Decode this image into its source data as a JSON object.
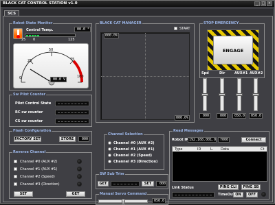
{
  "window": {
    "title": "BLACK CAT CONTROL STATION v1.0",
    "tab": "SCS"
  },
  "colors": {
    "group_title": "#9db7e8",
    "accent_red": "#d90000",
    "engage_stripe": "#e6c800"
  },
  "robot_state_monitor": {
    "title": "Robot State Monitor",
    "control_temp_label": "Control Temp.",
    "control_temp_value": "00.0 °",
    "scale_min": "25",
    "scale_zero": "0",
    "scale_max": "125",
    "gauge_ticks": [
      "0",
      "25",
      "50",
      "75",
      "100"
    ],
    "gauge_readout": "00.0 V"
  },
  "sw_pilot_counter": {
    "title": "Sw Pilot Counter",
    "rows": [
      "Pilot Control State",
      "RC sw counter",
      "CS sw counter"
    ]
  },
  "flash_configuration": {
    "title": "Flash Configuration",
    "factory_set": "FACTORY SET",
    "store": "STORE",
    "store_value": "000"
  },
  "reverse_channel": {
    "title": "Reverse Channel",
    "channels": [
      "Channel #0 (AUX #2)",
      "Channel #1 (AUX #1)",
      "Channel #2 (Speed)",
      "Channel #3 (Direction)"
    ],
    "set": "SET",
    "get": "GET"
  },
  "black_cat_manager": {
    "title": "BLACK CAT MANAGER",
    "start_label": "START",
    "top_readout": "000.0%",
    "bottom_readout": "000.0%"
  },
  "channel_selection": {
    "title": "Channel Selection",
    "options": [
      "Channel #0 (AUX #2)",
      "Channel #1 (AUX #1)",
      "Channel #2 (Speed)",
      "Channel #3 (Direction)"
    ]
  },
  "sw_sub_trim": {
    "title": "SW Sub Trim",
    "get": "GET",
    "set": "SET",
    "value": "000"
  },
  "manual_servo": {
    "title": "Manual Servo Command",
    "value": "050.0"
  },
  "stop_emergency": {
    "title": "STOP EMERGENCY",
    "engage": "ENGAGE"
  },
  "channels": {
    "labels": [
      "Spd",
      "Dir",
      "AUX#1",
      "AUX#2"
    ],
    "values": [
      "000",
      "000",
      "050.0",
      "050.0"
    ]
  },
  "read_messages": {
    "title": "Read Messages",
    "robot_ip_label": "Robot IP",
    "robot_ip": "192.168.001.05",
    "port": "7000",
    "connect": "Connect",
    "columns": [
      "Type",
      "ID",
      "L.",
      "Data",
      "Ct"
    ]
  },
  "link_status": {
    "label": "Link Status",
    "ping_cli": "PING CLI",
    "ping_sb": "PING SB",
    "timeout": "TimeOut",
    "on": "ON",
    "off": "OFF"
  }
}
